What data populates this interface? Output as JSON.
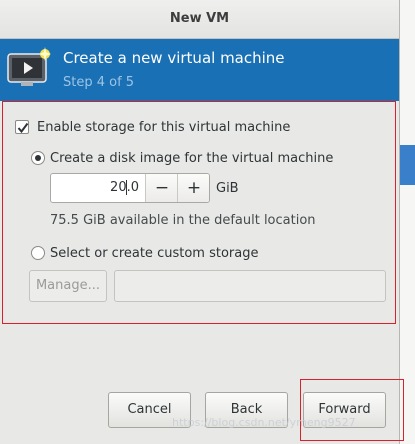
{
  "window": {
    "title": "New VM"
  },
  "banner": {
    "title": "Create a new virtual machine",
    "step": "Step 4 of 5",
    "icon": "vm-monitor-icon"
  },
  "storage": {
    "enable_label": "Enable storage for this virtual machine",
    "enable_checked": true,
    "disk_option_label": "Create a disk image for the virtual machine",
    "disk_option_selected": true,
    "size_value": "20.0",
    "size_unit": "GiB",
    "available_text": "75.5 GiB available in the default location",
    "custom_option_label": "Select or create custom storage",
    "custom_option_selected": false,
    "manage_label": "Manage...",
    "custom_path_value": ""
  },
  "buttons": {
    "cancel": "Cancel",
    "back": "Back",
    "forward": "Forward"
  },
  "watermark": "https://blog.csdn.net/ymeng9527",
  "colors": {
    "banner": "#1a70b4",
    "highlight_box": "#d8212a"
  }
}
